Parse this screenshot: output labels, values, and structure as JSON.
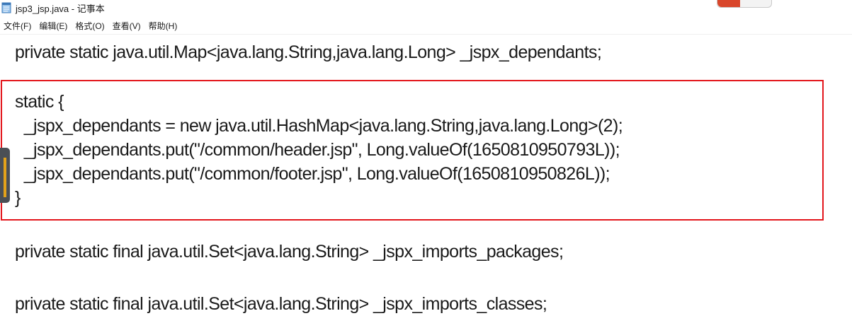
{
  "window": {
    "title": "jsp3_jsp.java - 记事本"
  },
  "menu": {
    "items": [
      {
        "label": "文件(F)",
        "name": "menu-file"
      },
      {
        "label": "编辑(E)",
        "name": "menu-edit"
      },
      {
        "label": "格式(O)",
        "name": "menu-format"
      },
      {
        "label": "查看(V)",
        "name": "menu-view"
      },
      {
        "label": "帮助(H)",
        "name": "menu-help"
      }
    ]
  },
  "editor": {
    "lines": [
      "private static java.util.Map<java.lang.String,java.lang.Long> _jspx_dependants;",
      "static {",
      "  _jspx_dependants = new java.util.HashMap<java.lang.String,java.lang.Long>(2);",
      "  _jspx_dependants.put(\"/common/header.jsp\", Long.valueOf(1650810950793L));",
      "  _jspx_dependants.put(\"/common/footer.jsp\", Long.valueOf(1650810950826L));",
      "}",
      "private static final java.util.Set<java.lang.String> _jspx_imports_packages;",
      "private static final java.util.Set<java.lang.String> _jspx_imports_classes;"
    ]
  },
  "colors": {
    "highlight_border": "#e3161c",
    "text": "#1a1a1a",
    "background": "#ffffff"
  },
  "icons": {
    "app": "notepad-icon"
  }
}
